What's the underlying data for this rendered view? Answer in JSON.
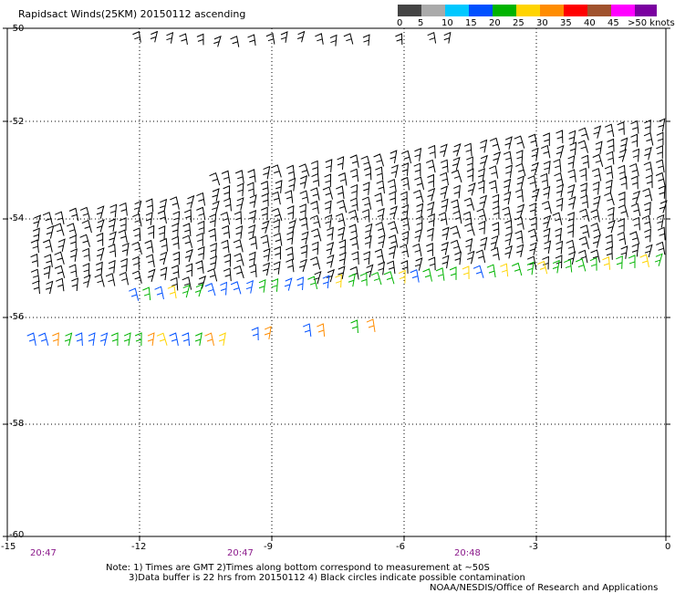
{
  "title": "Rapidsact Winds(25KM) 20150112 ascending",
  "legend": {
    "bins": [
      {
        "label": "0",
        "color": "#444444"
      },
      {
        "label": "5",
        "color": "#aaaaaa"
      },
      {
        "label": "10",
        "color": "#00c8ff"
      },
      {
        "label": "15",
        "color": "#0050ff"
      },
      {
        "label": "20",
        "color": "#00b400"
      },
      {
        "label": "25",
        "color": "#ffd400"
      },
      {
        "label": "30",
        "color": "#ff8c00"
      },
      {
        "label": "35",
        "color": "#ff0000"
      },
      {
        "label": "40",
        "color": "#a0522d"
      },
      {
        "label": "45",
        "color": "#ff00ff"
      },
      {
        "label": ">50 knots",
        "color": "#7a00a0"
      }
    ]
  },
  "axes": {
    "y_ticks": [
      "-50",
      "-52",
      "-54",
      "-56",
      "-58",
      "-60"
    ],
    "x_ticks": [
      "-15",
      "-12",
      "-9",
      "-6",
      "-3",
      "0"
    ],
    "times": [
      "20:47",
      "20:47",
      "20:48"
    ]
  },
  "notes": {
    "line1": "Note: 1) Times are GMT 2)Times along bottom correspond to measurement at ~50S",
    "line2": "3)Data buffer is 22 hrs from 20150112 4) Black circles indicate possible contamination",
    "line3": "NOAA/NESDIS/Office of Research and Applications"
  }
}
